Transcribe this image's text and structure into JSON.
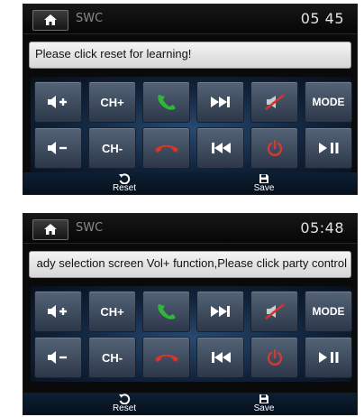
{
  "colors": {
    "accent_blue": "#1f3f66",
    "call_green": "#2fb53a",
    "hangup_red": "#d8322a",
    "power_red": "#d23a35"
  },
  "screens": [
    {
      "header": {
        "home_icon": "home-icon",
        "title": "SWC",
        "clock": "05 45"
      },
      "message": "Please click reset for learning!",
      "keys": {
        "vol_up": "",
        "ch_up": "CH+",
        "call": "",
        "next": "",
        "mute": "",
        "mode": "MODE",
        "vol_down": "",
        "ch_down": "CH-",
        "hangup": "",
        "prev": "",
        "power": "",
        "play_pause": ""
      },
      "bottom": {
        "reset_label": "Reset",
        "save_label": "Save"
      }
    },
    {
      "header": {
        "home_icon": "home-icon",
        "title": "SWC",
        "clock": "05:48"
      },
      "message": "ady selection screen Vol+ function,Please click party control",
      "keys": {
        "vol_up": "",
        "ch_up": "CH+",
        "call": "",
        "next": "",
        "mute": "",
        "mode": "MODE",
        "vol_down": "",
        "ch_down": "CH-",
        "hangup": "",
        "prev": "",
        "power": "",
        "play_pause": ""
      },
      "bottom": {
        "reset_label": "Reset",
        "save_label": "Save"
      }
    }
  ]
}
